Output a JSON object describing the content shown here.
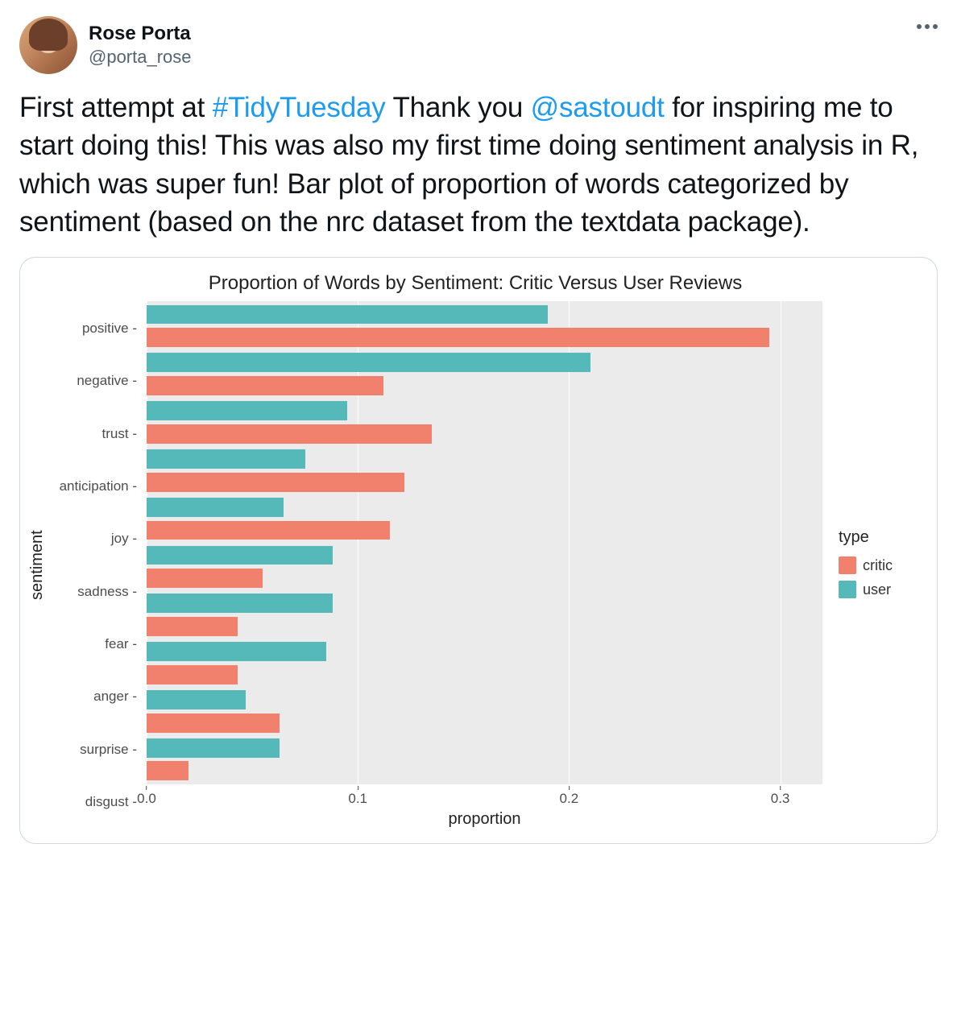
{
  "user": {
    "display_name": "Rose Porta",
    "handle": "@porta_rose"
  },
  "tweet": {
    "text_parts": [
      {
        "t": "First attempt at ",
        "link": false
      },
      {
        "t": "#TidyTuesday",
        "link": true
      },
      {
        "t": " Thank you ",
        "link": false
      },
      {
        "t": "@sastoudt",
        "link": true
      },
      {
        "t": " for inspiring me to start doing this! This was also my first time doing sentiment analysis in R, which was super fun! Bar plot of proportion of words categorized by sentiment (based on the nrc dataset from the textdata package).",
        "link": false
      }
    ]
  },
  "chart_data": {
    "type": "bar",
    "orientation": "horizontal",
    "title": "Proportion of Words by Sentiment: Critic Versus User Reviews",
    "xlabel": "proportion",
    "ylabel": "sentiment",
    "xlim": [
      0,
      0.32
    ],
    "xticks": [
      0.0,
      0.1,
      0.2,
      0.3
    ],
    "xtick_labels": [
      "0.0",
      "0.1",
      "0.2",
      "0.3"
    ],
    "categories": [
      "positive",
      "negative",
      "trust",
      "anticipation",
      "joy",
      "sadness",
      "fear",
      "anger",
      "surprise",
      "disgust"
    ],
    "series": [
      {
        "name": "user",
        "color": "#56b9b9",
        "values": [
          0.19,
          0.21,
          0.095,
          0.075,
          0.065,
          0.088,
          0.088,
          0.085,
          0.047,
          0.063
        ]
      },
      {
        "name": "critic",
        "color": "#f1806d",
        "values": [
          0.295,
          0.112,
          0.135,
          0.122,
          0.115,
          0.055,
          0.043,
          0.043,
          0.063,
          0.02
        ]
      }
    ],
    "legend": {
      "title": "type",
      "items": [
        "critic",
        "user"
      ],
      "position": "right"
    }
  }
}
